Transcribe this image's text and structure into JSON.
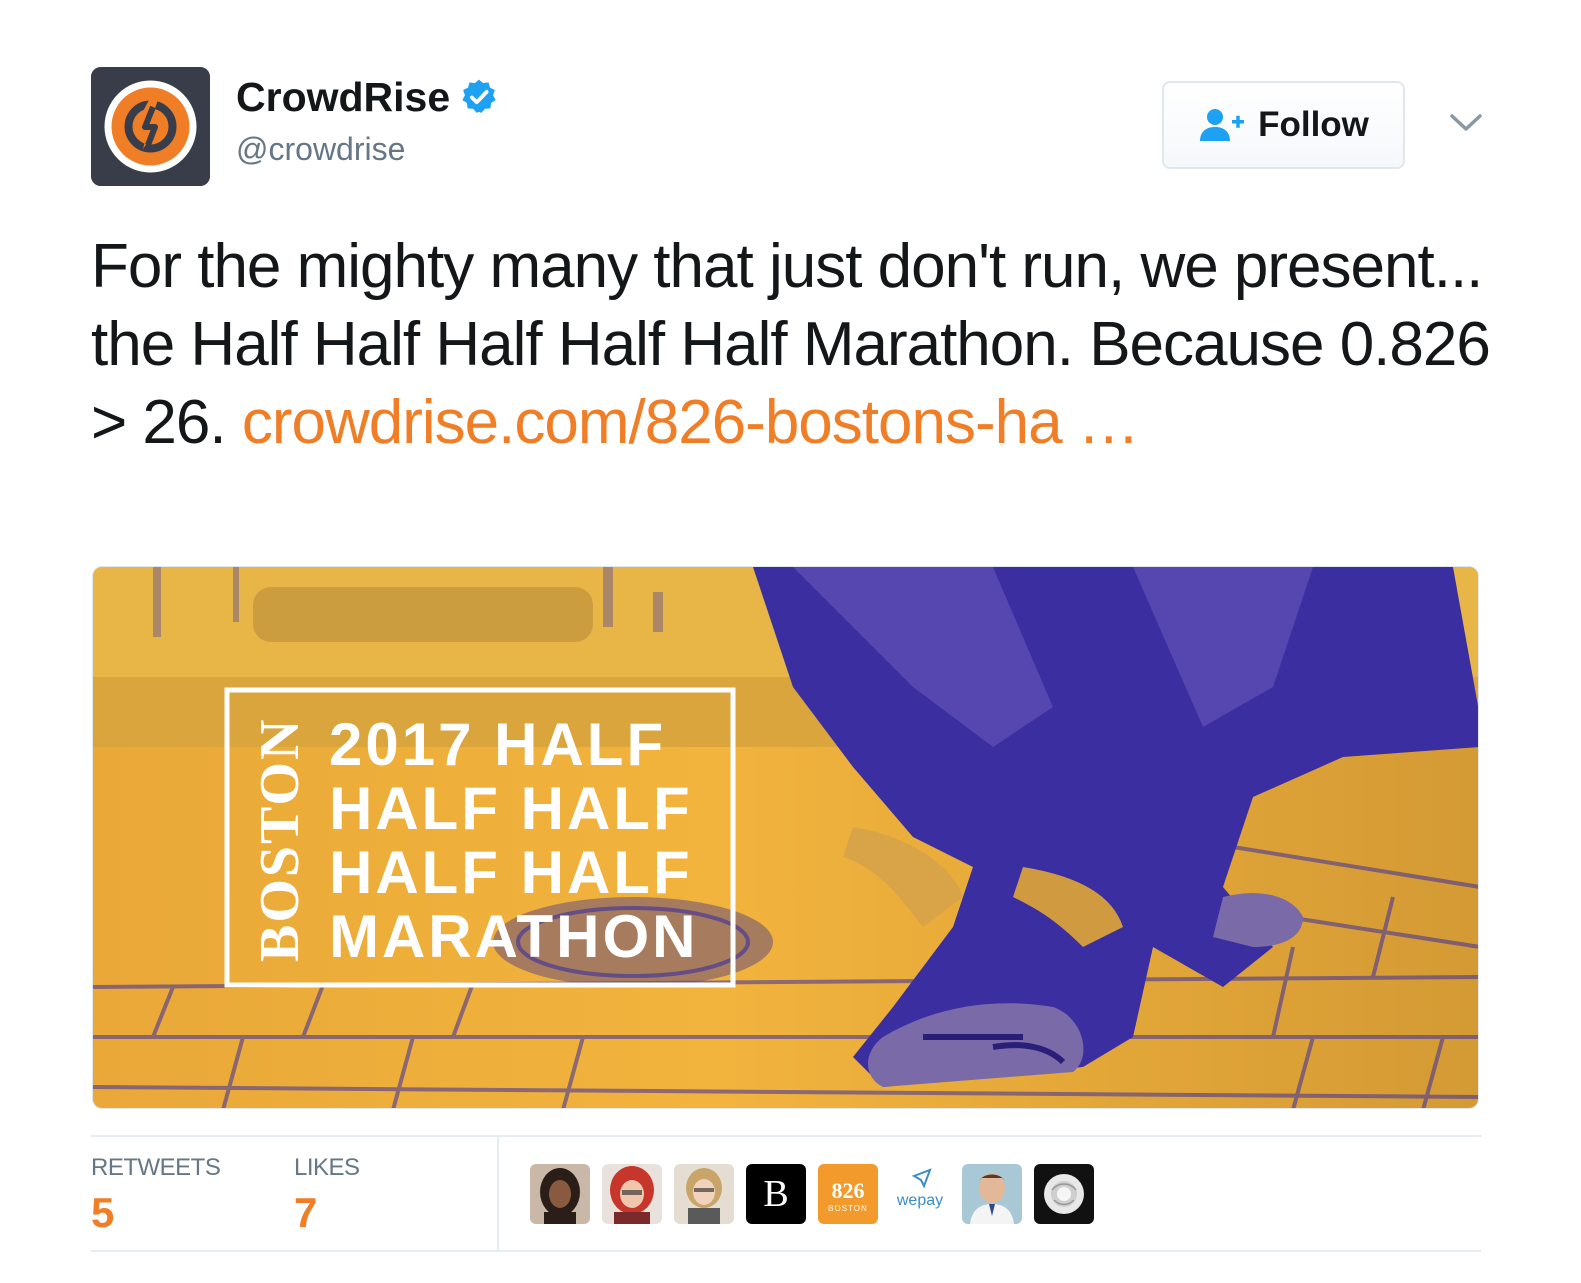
{
  "tweet": {
    "account": {
      "display_name": "CrowdRise",
      "handle": "@crowdrise",
      "verified": true,
      "avatar_icon": "crowdrise-logo-icon"
    },
    "follow_label": "Follow",
    "text_before_link": "For the mighty many that just don't run, we present... the Half Half Half Half Half Marathon. Because 0.826 > 26. ",
    "link_text": "crowdrise.com/826-bostons-ha …",
    "media": {
      "vertical_word": "BOSTON",
      "title_lines": [
        "2017 HALF",
        "HALF HALF",
        "HALF HALF",
        "MARATHON"
      ]
    },
    "stats": {
      "retweets_label": "RETWEETS",
      "retweets_count": "5",
      "likes_label": "LIKES",
      "likes_count": "7"
    },
    "likers": [
      {
        "name": "liker-avatar-1",
        "initial": ""
      },
      {
        "name": "liker-avatar-2",
        "initial": ""
      },
      {
        "name": "liker-avatar-3",
        "initial": ""
      },
      {
        "name": "liker-avatar-b",
        "initial": "B"
      },
      {
        "name": "liker-avatar-826",
        "initial": "826",
        "sub": "BOSTON"
      },
      {
        "name": "liker-avatar-wepay",
        "initial": "wepay"
      },
      {
        "name": "liker-avatar-7",
        "initial": ""
      },
      {
        "name": "liker-avatar-rose",
        "initial": ""
      }
    ]
  },
  "colors": {
    "link": "#f07e26",
    "verified": "#1da1f2",
    "secondary_text": "#657786",
    "media_yellow": "#f3b33a",
    "media_purple": "#3b2ea0"
  }
}
